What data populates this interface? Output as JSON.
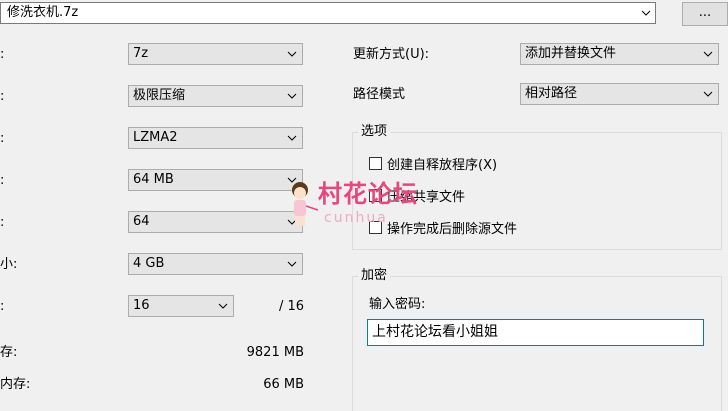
{
  "archive": {
    "name": "修洗衣机.7z",
    "browse_label": "..."
  },
  "left": {
    "rows": [
      {
        "label": ":",
        "value": "7z"
      },
      {
        "label": ":",
        "value": "极限压缩"
      },
      {
        "label": ":",
        "value": "LZMA2"
      },
      {
        "label": ":",
        "value": "64 MB"
      },
      {
        "label": ":",
        "value": "64"
      },
      {
        "label": "小:",
        "value": "4 GB"
      }
    ],
    "threads": {
      "label": ":",
      "value": "16",
      "total": "/ 16"
    },
    "memory": [
      {
        "label": "存:",
        "value": "9821 MB"
      },
      {
        "label": "内存:",
        "value": "66 MB"
      }
    ]
  },
  "right": {
    "update_mode": {
      "label": "更新方式(U):",
      "value": "添加并替换文件"
    },
    "path_mode": {
      "label": "路径模式",
      "value": "相对路径"
    },
    "options": {
      "title": "选项",
      "items": [
        {
          "label": "创建自释放程序(X)"
        },
        {
          "label": "压缩共享文件"
        },
        {
          "label": "操作完成后删除源文件"
        }
      ]
    },
    "encryption": {
      "title": "加密",
      "password_label": "输入密码:",
      "password_value": "上村花论坛看小姐姐"
    }
  },
  "watermark": {
    "text": "村花论坛",
    "sub": "cunhua"
  },
  "colors": {
    "accent": "#0078d7",
    "watermark": "#e8467c"
  }
}
